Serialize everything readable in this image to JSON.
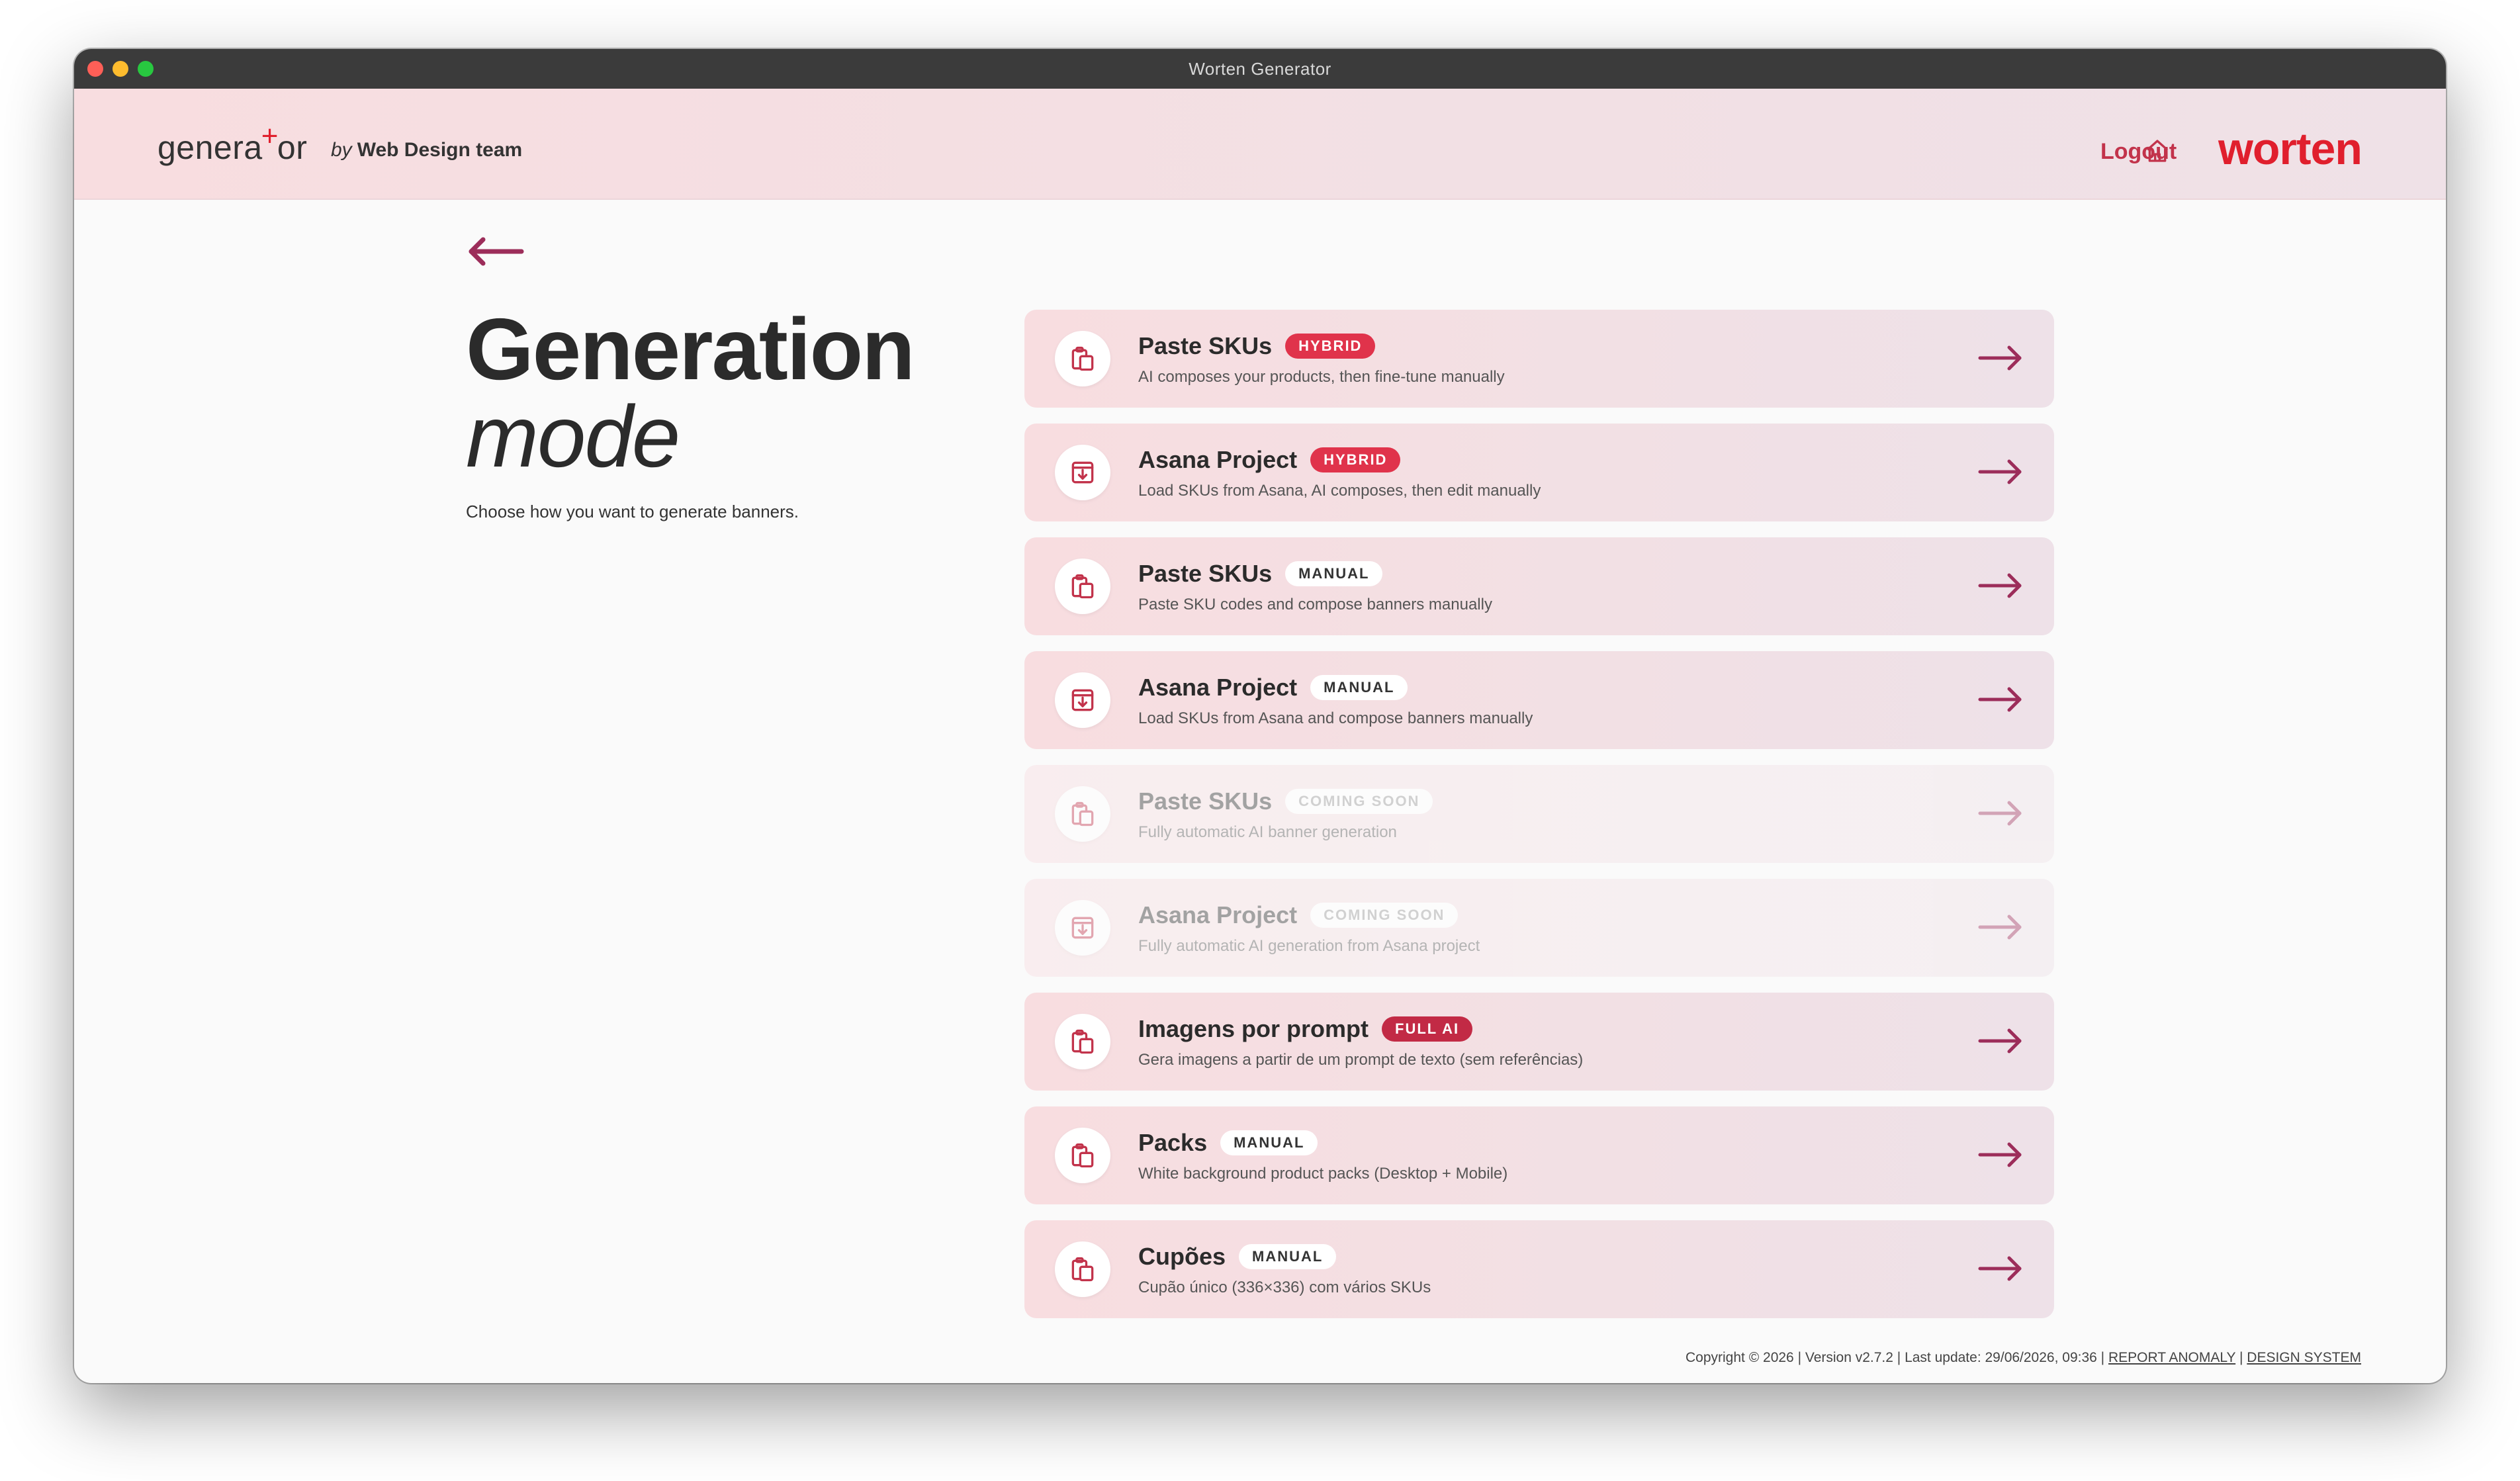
{
  "window": {
    "title": "Worten Generator"
  },
  "header": {
    "logo_left": "genera",
    "logo_plus": "+",
    "logo_right": "or",
    "byline_by": "by",
    "byline_team": "Web Design team",
    "logout_label": "Logout",
    "brand": "worten"
  },
  "hero": {
    "title": "Generation",
    "subtitle": "mode",
    "description": "Choose how you want to generate banners."
  },
  "cards": [
    {
      "title": "Paste SKUs",
      "badge": "HYBRID",
      "description": "AI composes your products, then fine-tune manually",
      "icon": "clipboard-icon"
    },
    {
      "title": "Asana Project",
      "badge": "HYBRID",
      "description": "Load SKUs from Asana, AI composes, then edit manually",
      "icon": "download-box-icon"
    },
    {
      "title": "Paste SKUs",
      "badge": "MANUAL",
      "description": "Paste SKU codes and compose banners manually",
      "icon": "clipboard-icon"
    },
    {
      "title": "Asana Project",
      "badge": "MANUAL",
      "description": "Load SKUs from Asana and compose banners manually",
      "icon": "download-box-icon"
    },
    {
      "title": "Paste SKUs",
      "badge": "COMING SOON",
      "description": "Fully automatic AI banner generation",
      "icon": "clipboard-icon"
    },
    {
      "title": "Asana Project",
      "badge": "COMING SOON",
      "description": "Fully automatic AI generation from Asana project",
      "icon": "download-box-icon"
    },
    {
      "title": "Imagens por prompt",
      "badge": "FULL AI",
      "description": "Gera imagens a partir de um prompt de texto (sem referências)",
      "icon": "clipboard-icon"
    },
    {
      "title": "Packs",
      "badge": "MANUAL",
      "description": "White background product packs (Desktop + Mobile)",
      "icon": "clipboard-icon"
    },
    {
      "title": "Cupões",
      "badge": "MANUAL",
      "description": "Cupão único (336×336) com vários SKUs",
      "icon": "clipboard-icon"
    }
  ],
  "footer": {
    "text": "Copyright © 2026 | Version v2.7.2 | Last update: 29/06/2026, 09:36 |",
    "separator": "|",
    "report_link": "REPORT ANOMALY",
    "design_link": "DESIGN SYSTEM"
  },
  "colors": {
    "accent": "#e01f2d",
    "arrow": "#9c2d5a",
    "icon": "#c2334b"
  }
}
